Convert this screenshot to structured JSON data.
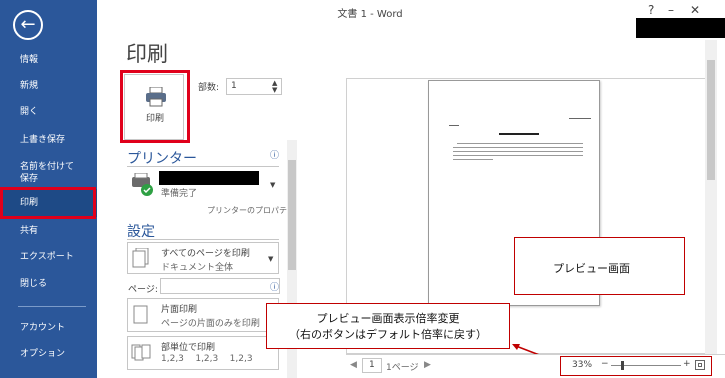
{
  "window": {
    "title": "文書 1 - Word",
    "help": "?",
    "minimize": "–",
    "close": "✕"
  },
  "nav": {
    "back_icon": "back-arrow",
    "items": [
      "情報",
      "新規",
      "開く",
      "上書き保存",
      "名前を付けて\n保存",
      "印刷",
      "共有",
      "エクスポート",
      "閉じる",
      "アカウント",
      "オプション"
    ],
    "selected": "印刷"
  },
  "print": {
    "heading": "印刷",
    "print_button_label": "印刷",
    "copies_label": "部数:",
    "copies_value": "1"
  },
  "printer": {
    "section_title": "プリンター",
    "status": "準備完了",
    "properties_link": "プリンターのプロパティ"
  },
  "settings": {
    "section_title": "設定",
    "pages_main": "すべてのページを印刷",
    "pages_sub": "ドキュメント全体",
    "pages_label": "ページ:",
    "sided_main": "片面印刷",
    "sided_sub": "ページの片面のみを印刷",
    "collate_main": "部単位で印刷",
    "collate_sub": "1,2,3    1,2,3    1,2,3"
  },
  "preview": {
    "page_value": "1",
    "page_suffix": "1ページ",
    "zoom": "33%",
    "callout_preview": "プレビュー画面",
    "callout_zoom_line1": "プレビュー画面表示倍率変更",
    "callout_zoom_line2": "（右のボタンはデフォルト倍率に戻す）"
  },
  "colors": {
    "nav_bg": "#2b579a",
    "accent": "#2b579a",
    "highlight": "#e0001b"
  }
}
